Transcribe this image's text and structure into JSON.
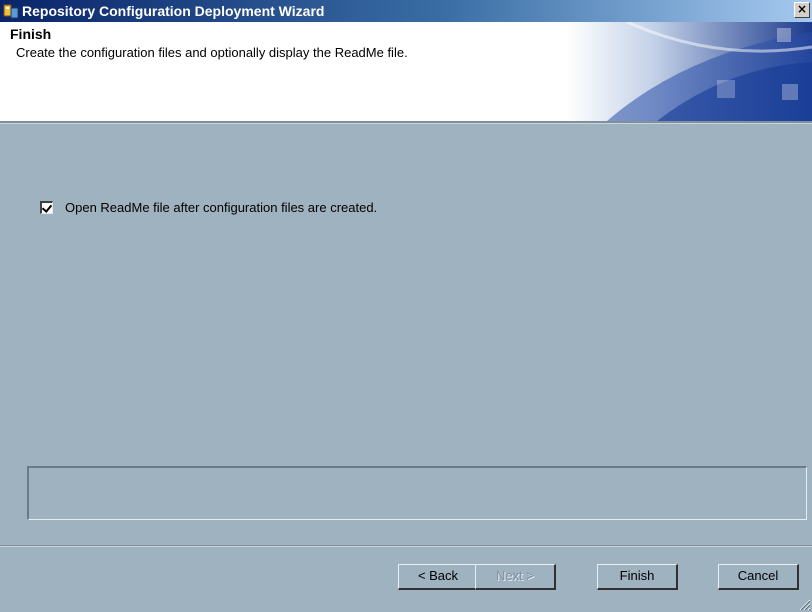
{
  "window": {
    "title": "Repository Configuration Deployment Wizard",
    "close_label": "×"
  },
  "header": {
    "title": "Finish",
    "subtitle": "Create the configuration files and optionally display the ReadMe file."
  },
  "options": {
    "open_readme_label": "Open ReadMe file after configuration files are created.",
    "open_readme_checked": true
  },
  "status": {
    "text": ""
  },
  "buttons": {
    "back": "< Back",
    "next": "Next >",
    "finish": "Finish",
    "cancel": "Cancel"
  },
  "colors": {
    "dialog_background": "#9fb2c0",
    "title_bar": "#0a246a",
    "header_background": "#ffffff"
  }
}
